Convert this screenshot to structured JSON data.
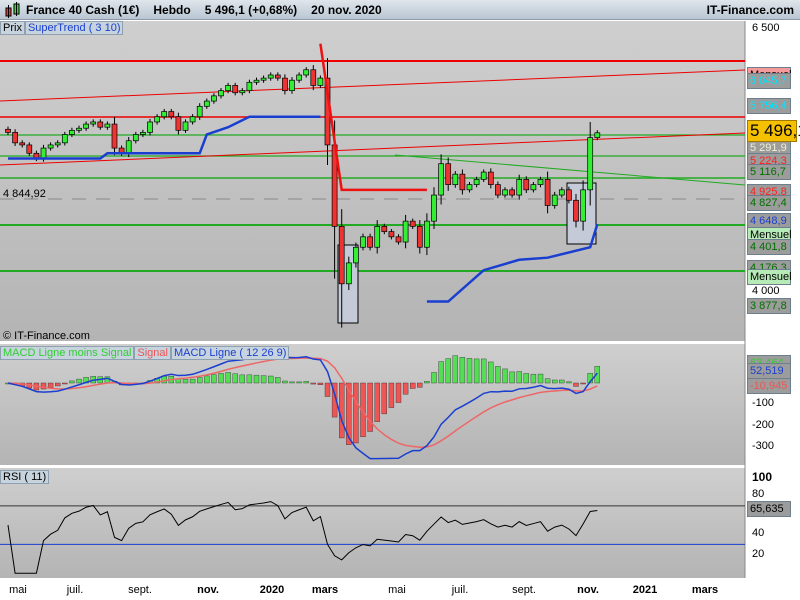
{
  "header": {
    "instrument": "France 40 Cash (1€)",
    "period": "Hebdo",
    "price": "5 496,1 (+0,68%)",
    "date": "20 nov. 2020",
    "brand": "IT-Finance.com"
  },
  "price_panel": {
    "tabs": [
      "Prix",
      "SuperTrend ( 3 10)"
    ],
    "copyright": "© IT-Finance.com",
    "left_level": "4 844,92",
    "axis_ticks": [
      "6 500",
      "4 000"
    ],
    "levels": [
      {
        "label": "Mensuel",
        "price": 6045.7,
        "fg": "#000",
        "bg": "#f59a9a"
      },
      {
        "label": "6 045,7",
        "price": 5990,
        "fg": "#00e5ff",
        "bg": "#9c9c9c"
      },
      {
        "label": "5 756,4",
        "price": 5756.4,
        "fg": "#00e5ff",
        "bg": "#9c9c9c"
      },
      {
        "label": "5 291,9",
        "price": 5350,
        "fg": "#f0f0d0",
        "bg": "#9c9c9c"
      },
      {
        "label": "5 224,3",
        "price": 5224.3,
        "fg": "#ff2020",
        "bg": "#9c9c9c"
      },
      {
        "label": "5 116,7",
        "price": 5116.7,
        "fg": "#007000",
        "bg": "#9c9c9c"
      },
      {
        "label": "4 925,8",
        "price": 4925.8,
        "fg": "#ff2020",
        "bg": "#9c9c9c"
      },
      {
        "label": "4 827,4",
        "price": 4827.4,
        "fg": "#007000",
        "bg": "#9c9c9c"
      },
      {
        "label": "4 648,9",
        "price": 4648.9,
        "fg": "#1a3fd0",
        "bg": "#9c9c9c"
      },
      {
        "label": "Mensuel",
        "price": 4520,
        "fg": "#000",
        "bg": "#b6eab6"
      },
      {
        "label": "4 401,8",
        "price": 4401.8,
        "fg": "#007000",
        "bg": "#9c9c9c"
      },
      {
        "label": "4 176,3",
        "price": 4205,
        "fg": "#007000",
        "bg": "#9c9c9c"
      },
      {
        "label": "Mensuel",
        "price": 4040,
        "fg": "#000",
        "bg": "#b6eab6"
      },
      {
        "label": "3 877,8",
        "price": 3877.8,
        "fg": "#007000",
        "bg": "#9c9c9c"
      }
    ],
    "current_price": "5 496,1"
  },
  "macd_panel": {
    "tabs": [
      "MACD Ligne moins Signal",
      "Signal",
      "MACD Ligne ( 12 26 9)"
    ],
    "values": [
      "63,464",
      "52,519",
      "-10,945"
    ],
    "axis_ticks": [
      "-100",
      "-200",
      "-300"
    ]
  },
  "rsi_panel": {
    "tabs": [
      "RSI ( 11)"
    ],
    "value": "65,635",
    "axis_ticks": [
      "100",
      "80",
      "40",
      "20"
    ]
  },
  "date_axis": [
    "mai",
    "juil.",
    "sept.",
    "nov.",
    "2020",
    "mars",
    "mai",
    "juil.",
    "sept.",
    "nov.",
    "2021",
    "mars"
  ],
  "chart_data": {
    "type": "candlestick",
    "ylim": [
      3600,
      6600
    ],
    "closes": [
      5500,
      5400,
      5380,
      5300,
      5250,
      5350,
      5380,
      5400,
      5480,
      5520,
      5540,
      5580,
      5600,
      5550,
      5580,
      5350,
      5300,
      5420,
      5480,
      5500,
      5600,
      5650,
      5700,
      5650,
      5520,
      5600,
      5650,
      5750,
      5800,
      5850,
      5900,
      5950,
      5880,
      5900,
      5980,
      6000,
      6020,
      6050,
      6020,
      5900,
      6000,
      6050,
      6100,
      5950,
      6020,
      5380,
      4600,
      4050,
      4250,
      4400,
      4500,
      4400,
      4600,
      4550,
      4500,
      4450,
      4650,
      4600,
      4400,
      4650,
      4900,
      5200,
      5000,
      5100,
      4950,
      5000,
      5050,
      5120,
      5000,
      4900,
      4950,
      4900,
      5050,
      4950,
      5000,
      5050,
      4800,
      4900,
      4950,
      4850,
      4650,
      4950,
      5450,
      5496.1
    ],
    "supertrend_up": [
      [
        0,
        5250
      ],
      [
        13,
        5250
      ],
      [
        14,
        5300
      ],
      [
        27,
        5300
      ],
      [
        28,
        5480
      ],
      [
        31,
        5550
      ],
      [
        34,
        5650
      ],
      [
        44,
        5650
      ]
    ],
    "supertrend_down": [
      [
        44,
        6350
      ],
      [
        47,
        4950
      ],
      [
        59,
        4950
      ]
    ],
    "supertrend_up2": [
      [
        59,
        3880
      ],
      [
        62,
        3880
      ],
      [
        67,
        4180
      ],
      [
        72,
        4280
      ],
      [
        76,
        4300
      ],
      [
        82,
        4400
      ],
      [
        83,
        4620
      ]
    ],
    "colors": {
      "up": "#33ee33",
      "down": "#ee3333",
      "supertrend_up": "#1a3fd0",
      "supertrend_down": "#ee1111"
    }
  }
}
